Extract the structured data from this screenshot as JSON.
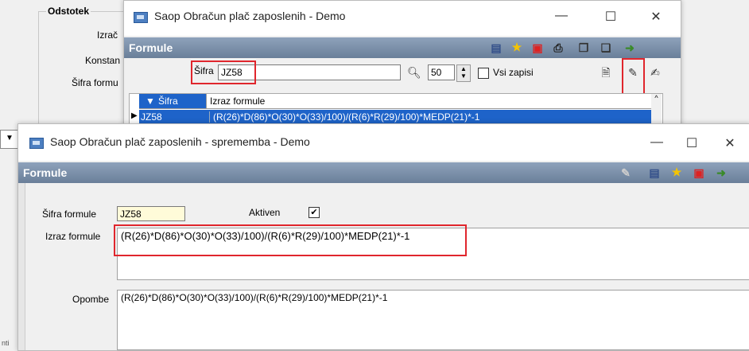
{
  "background": {
    "group_title": "Odstotek",
    "labels": [
      "Izrač",
      "Konstan",
      "Šifra formu"
    ],
    "left_bottom_text": "nti"
  },
  "window1": {
    "title": "Saop Obračun plač zaposlenih - Demo",
    "minimize": "—",
    "maximize": "☐",
    "close": "✕",
    "section_title": "Formule",
    "search": {
      "label": "Šifra",
      "value": "JZ58",
      "count": "50",
      "all_records_label": "Vsi zapisi"
    },
    "grid": {
      "columns": [
        "Šifra",
        "Izraz formule"
      ],
      "rows": [
        {
          "code": "JZ58",
          "formula": "(R(26)*D(86)*O(30)*O(33)/100)/(R(6)*R(29)/100)*MEDP(21)*-1"
        }
      ]
    }
  },
  "window2": {
    "title": "Saop Obračun plač zaposlenih - sprememba - Demo",
    "minimize": "—",
    "maximize": "☐",
    "close": "✕",
    "section_title": "Formule",
    "code_label": "Šifra formule",
    "code_value": "JZ58",
    "active_label": "Aktiven",
    "active_checked": "✔",
    "formula_label": "Izraz formule",
    "formula_value": "(R(26)*D(86)*O(30)*O(33)/100)/(R(6)*R(29)/100)*MEDP(21)*-1",
    "notes_label": "Opombe",
    "notes_value": "(R(26)*D(86)*O(30)*O(33)/100)/(R(6)*R(29)/100)*MEDP(21)*-1"
  },
  "colors": {
    "accent_red": "#e0262d",
    "section_bar": "#7a8fa8",
    "selection": "#1e63c9"
  }
}
